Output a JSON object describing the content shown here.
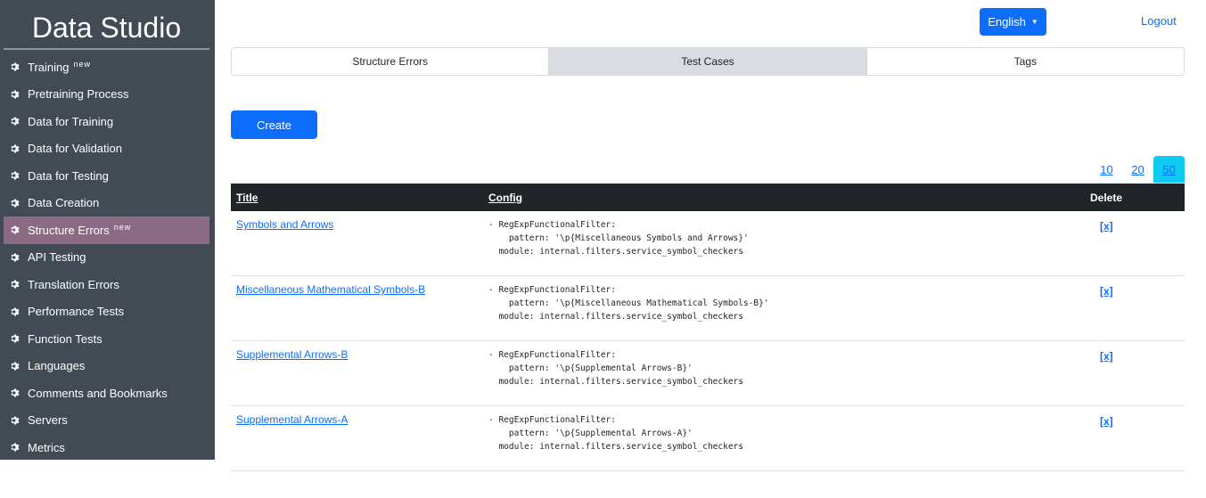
{
  "app": {
    "title": "Data Studio"
  },
  "sidebar": {
    "items": [
      {
        "label": "Training",
        "badge": "new"
      },
      {
        "label": "Pretraining Process"
      },
      {
        "label": "Data for Training"
      },
      {
        "label": "Data for Validation"
      },
      {
        "label": "Data for Testing"
      },
      {
        "label": "Data Creation"
      },
      {
        "label": "Structure Errors",
        "badge": "new",
        "active": true
      },
      {
        "label": "API Testing"
      },
      {
        "label": "Translation Errors"
      },
      {
        "label": "Performance Tests"
      },
      {
        "label": "Function Tests"
      },
      {
        "label": "Languages"
      },
      {
        "label": "Comments and Bookmarks"
      },
      {
        "label": "Servers"
      },
      {
        "label": "Metrics"
      }
    ]
  },
  "header": {
    "language": "English",
    "logout": "Logout"
  },
  "tabs": [
    {
      "label": "Structure Errors"
    },
    {
      "label": "Test Cases",
      "active": true
    },
    {
      "label": "Tags"
    }
  ],
  "actions": {
    "create": "Create"
  },
  "pagesize": {
    "options": [
      "10",
      "20",
      "50"
    ],
    "selected": "50"
  },
  "table": {
    "headers": {
      "title": "Title",
      "config": "Config",
      "delete": "Delete"
    },
    "rows": [
      {
        "title": "Symbols and Arrows",
        "config": "- RegExpFunctionalFilter:\n    pattern: '\\p{Miscellaneous Symbols and Arrows}'\n  module: internal.filters.service_symbol_checkers",
        "delete": "[x]"
      },
      {
        "title": "Miscellaneous Mathematical Symbols-B",
        "config": "- RegExpFunctionalFilter:\n    pattern: '\\p{Miscellaneous Mathematical Symbols-B}'\n  module: internal.filters.service_symbol_checkers",
        "delete": "[x]"
      },
      {
        "title": "Supplemental Arrows-B",
        "config": "- RegExpFunctionalFilter:\n    pattern: '\\p{Supplemental Arrows-B}'\n  module: internal.filters.service_symbol_checkers",
        "delete": "[x]"
      },
      {
        "title": "Supplemental Arrows-A",
        "config": "- RegExpFunctionalFilter:\n    pattern: '\\p{Supplemental Arrows-A}'\n  module: internal.filters.service_symbol_checkers",
        "delete": "[x]"
      }
    ]
  },
  "colors": {
    "sidebar_bg": "#424b54",
    "sidebar_active": "#8c6a84",
    "primary": "#0d6efd",
    "table_header": "#212529",
    "pagesize_active": "#0dcaf0"
  }
}
